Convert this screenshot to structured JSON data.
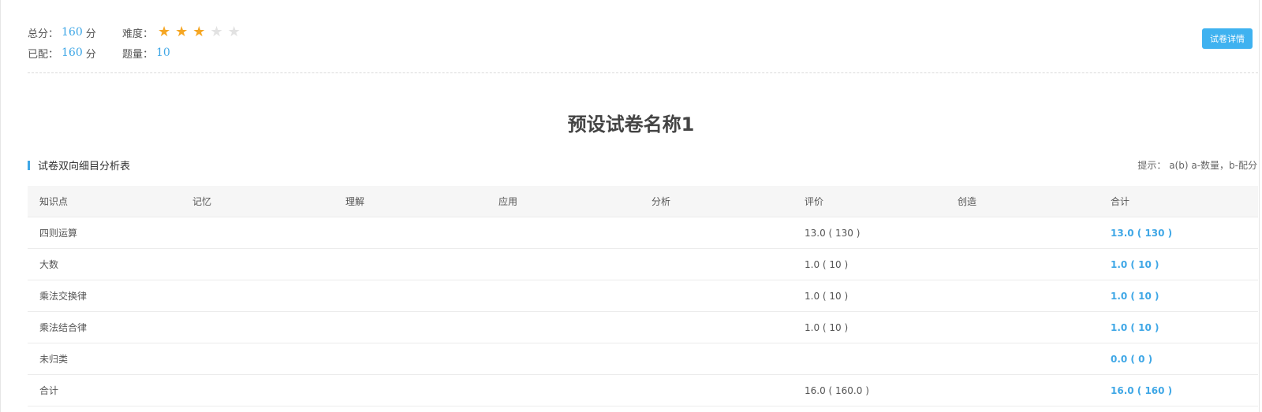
{
  "summary": {
    "total_label": "总分：",
    "total_value": "160",
    "total_unit": "分",
    "assigned_label": "已配：",
    "assigned_value": "160",
    "assigned_unit": "分",
    "difficulty_label": "难度：",
    "difficulty_rating": 3,
    "difficulty_max": 5,
    "count_label": "题量：",
    "count_value": "10"
  },
  "detail_button_label": "试卷详情",
  "paper_title": "预设试卷名称1",
  "section": {
    "title": "试卷双向细目分析表",
    "hint": "提示： a(b) a-数量，b-配分"
  },
  "table": {
    "headers": [
      "知识点",
      "记忆",
      "理解",
      "应用",
      "分析",
      "评价",
      "创造",
      "合计"
    ],
    "rows": [
      [
        "四则运算",
        "",
        "",
        "",
        "",
        "13.0 ( 130 )",
        "",
        "13.0 ( 130 )"
      ],
      [
        "大数",
        "",
        "",
        "",
        "",
        "1.0 ( 10 )",
        "",
        "1.0 ( 10 )"
      ],
      [
        "乘法交换律",
        "",
        "",
        "",
        "",
        "1.0 ( 10 )",
        "",
        "1.0 ( 10 )"
      ],
      [
        "乘法结合律",
        "",
        "",
        "",
        "",
        "1.0 ( 10 )",
        "",
        "1.0 ( 10 )"
      ],
      [
        "未归类",
        "",
        "",
        "",
        "",
        "",
        "",
        "0.0 ( 0 )"
      ],
      [
        "合计",
        "",
        "",
        "",
        "",
        "16.0 ( 160.0 )",
        "",
        "16.0 ( 160 )"
      ]
    ]
  },
  "colors": {
    "accent": "#3fa7e6",
    "button": "#3fb2f0",
    "star_on": "#f5a623",
    "star_off": "#e2e2e2"
  }
}
